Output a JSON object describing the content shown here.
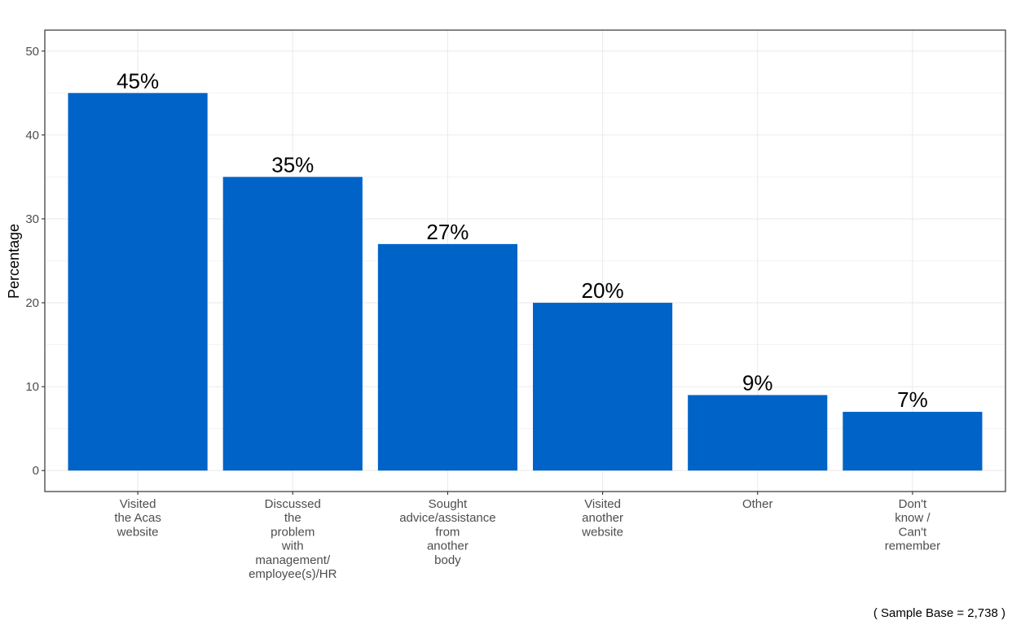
{
  "chart_data": {
    "type": "bar",
    "title": "",
    "xlabel": "",
    "ylabel": "Percentage",
    "ylim": [
      -2.5,
      52.5
    ],
    "yticks": [
      0,
      10,
      20,
      30,
      40,
      50
    ],
    "grid": true,
    "legend": "none",
    "bar_color": "#0063c8",
    "categories": [
      [
        "Visited",
        "the Acas",
        "website"
      ],
      [
        "Discussed",
        "the",
        "problem",
        "with",
        "management/",
        "employee(s)/HR"
      ],
      [
        "Sought",
        "advice/assistance",
        "from",
        "another",
        "body"
      ],
      [
        "Visited",
        "another",
        "website"
      ],
      [
        "Other"
      ],
      [
        "Don't",
        "know /",
        "Can't",
        "remember"
      ]
    ],
    "values": [
      45,
      35,
      27,
      20,
      9,
      7
    ],
    "data_labels": [
      "45%",
      "35%",
      "27%",
      "20%",
      "9%",
      "7%"
    ],
    "caption": "( Sample Base =  2,738 )"
  }
}
